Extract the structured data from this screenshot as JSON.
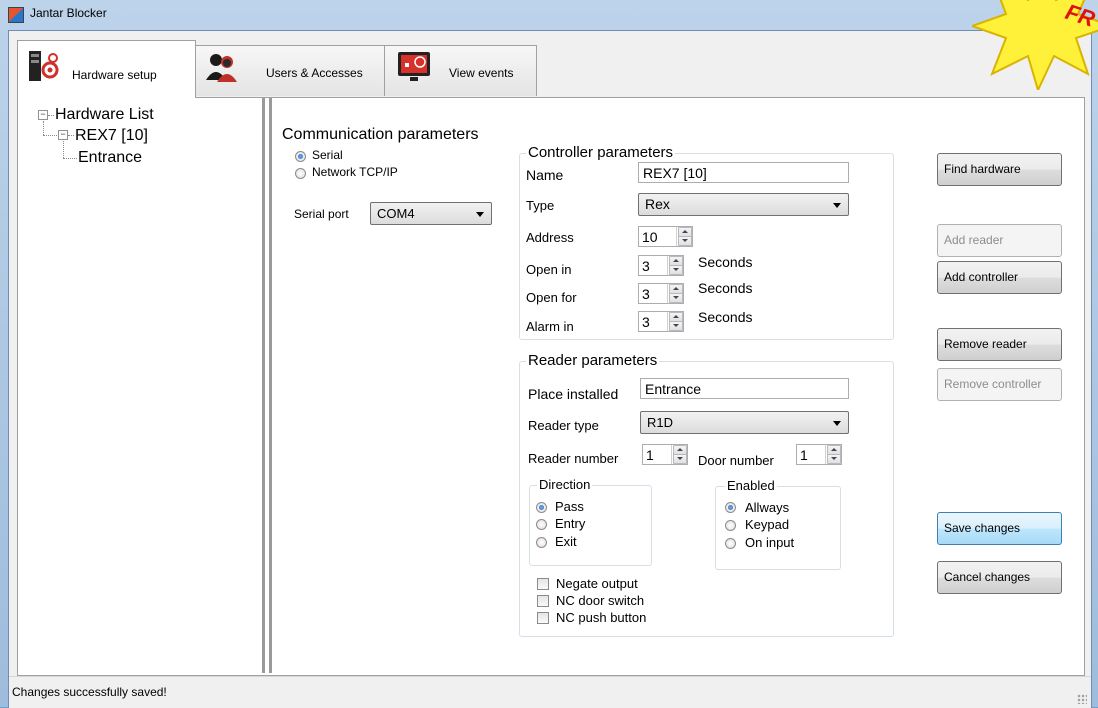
{
  "window": {
    "title": "Jantar Blocker"
  },
  "tabs": [
    {
      "label": "Hardware setup",
      "icon": "hardware-setup-icon",
      "active": true
    },
    {
      "label": "Users & Accesses",
      "icon": "users-icon",
      "active": false
    },
    {
      "label": "View events",
      "icon": "monitor-icon",
      "active": false
    }
  ],
  "tree": {
    "root": "Hardware List",
    "controller": "REX7 [10]",
    "reader": "Entrance"
  },
  "communication": {
    "title": "Communication parameters",
    "serial_label": "Serial",
    "network_label": "Network TCP/IP",
    "selected": "Serial",
    "port_label": "Serial port",
    "port_value": "COM4"
  },
  "controller": {
    "title": "Controller parameters",
    "name_label": "Name",
    "name_value": "REX7 [10]",
    "type_label": "Type",
    "type_value": "Rex",
    "address_label": "Address",
    "address_value": "10",
    "open_in_label": "Open in",
    "open_in_value": "3",
    "open_for_label": "Open for",
    "open_for_value": "3",
    "alarm_in_label": "Alarm in",
    "alarm_in_value": "3",
    "seconds_label": "Seconds"
  },
  "reader": {
    "title": "Reader parameters",
    "place_label": "Place installed",
    "place_value": "Entrance",
    "type_label": "Reader type",
    "type_value": "R1D",
    "number_label": "Reader number",
    "number_value": "1",
    "door_label": "Door number",
    "door_value": "1",
    "direction": {
      "title": "Direction",
      "options": [
        "Pass",
        "Entry",
        "Exit"
      ],
      "selected": "Pass"
    },
    "enabled": {
      "title": "Enabled",
      "options": [
        "Allways",
        "Keypad",
        "On input"
      ],
      "selected": "Allways"
    },
    "checks": [
      {
        "label": "Negate output",
        "checked": false
      },
      {
        "label": "NC door switch",
        "checked": false
      },
      {
        "label": "NC push button",
        "checked": false
      }
    ]
  },
  "buttons": {
    "find_hardware": "Find hardware",
    "add_reader": "Add reader",
    "add_controller": "Add controller",
    "remove_reader": "Remove reader",
    "remove_controller": "Remove controller",
    "save_changes": "Save changes",
    "cancel_changes": "Cancel changes"
  },
  "status": {
    "text": "Changes successfully saved!"
  },
  "promo": {
    "text": "FR"
  }
}
